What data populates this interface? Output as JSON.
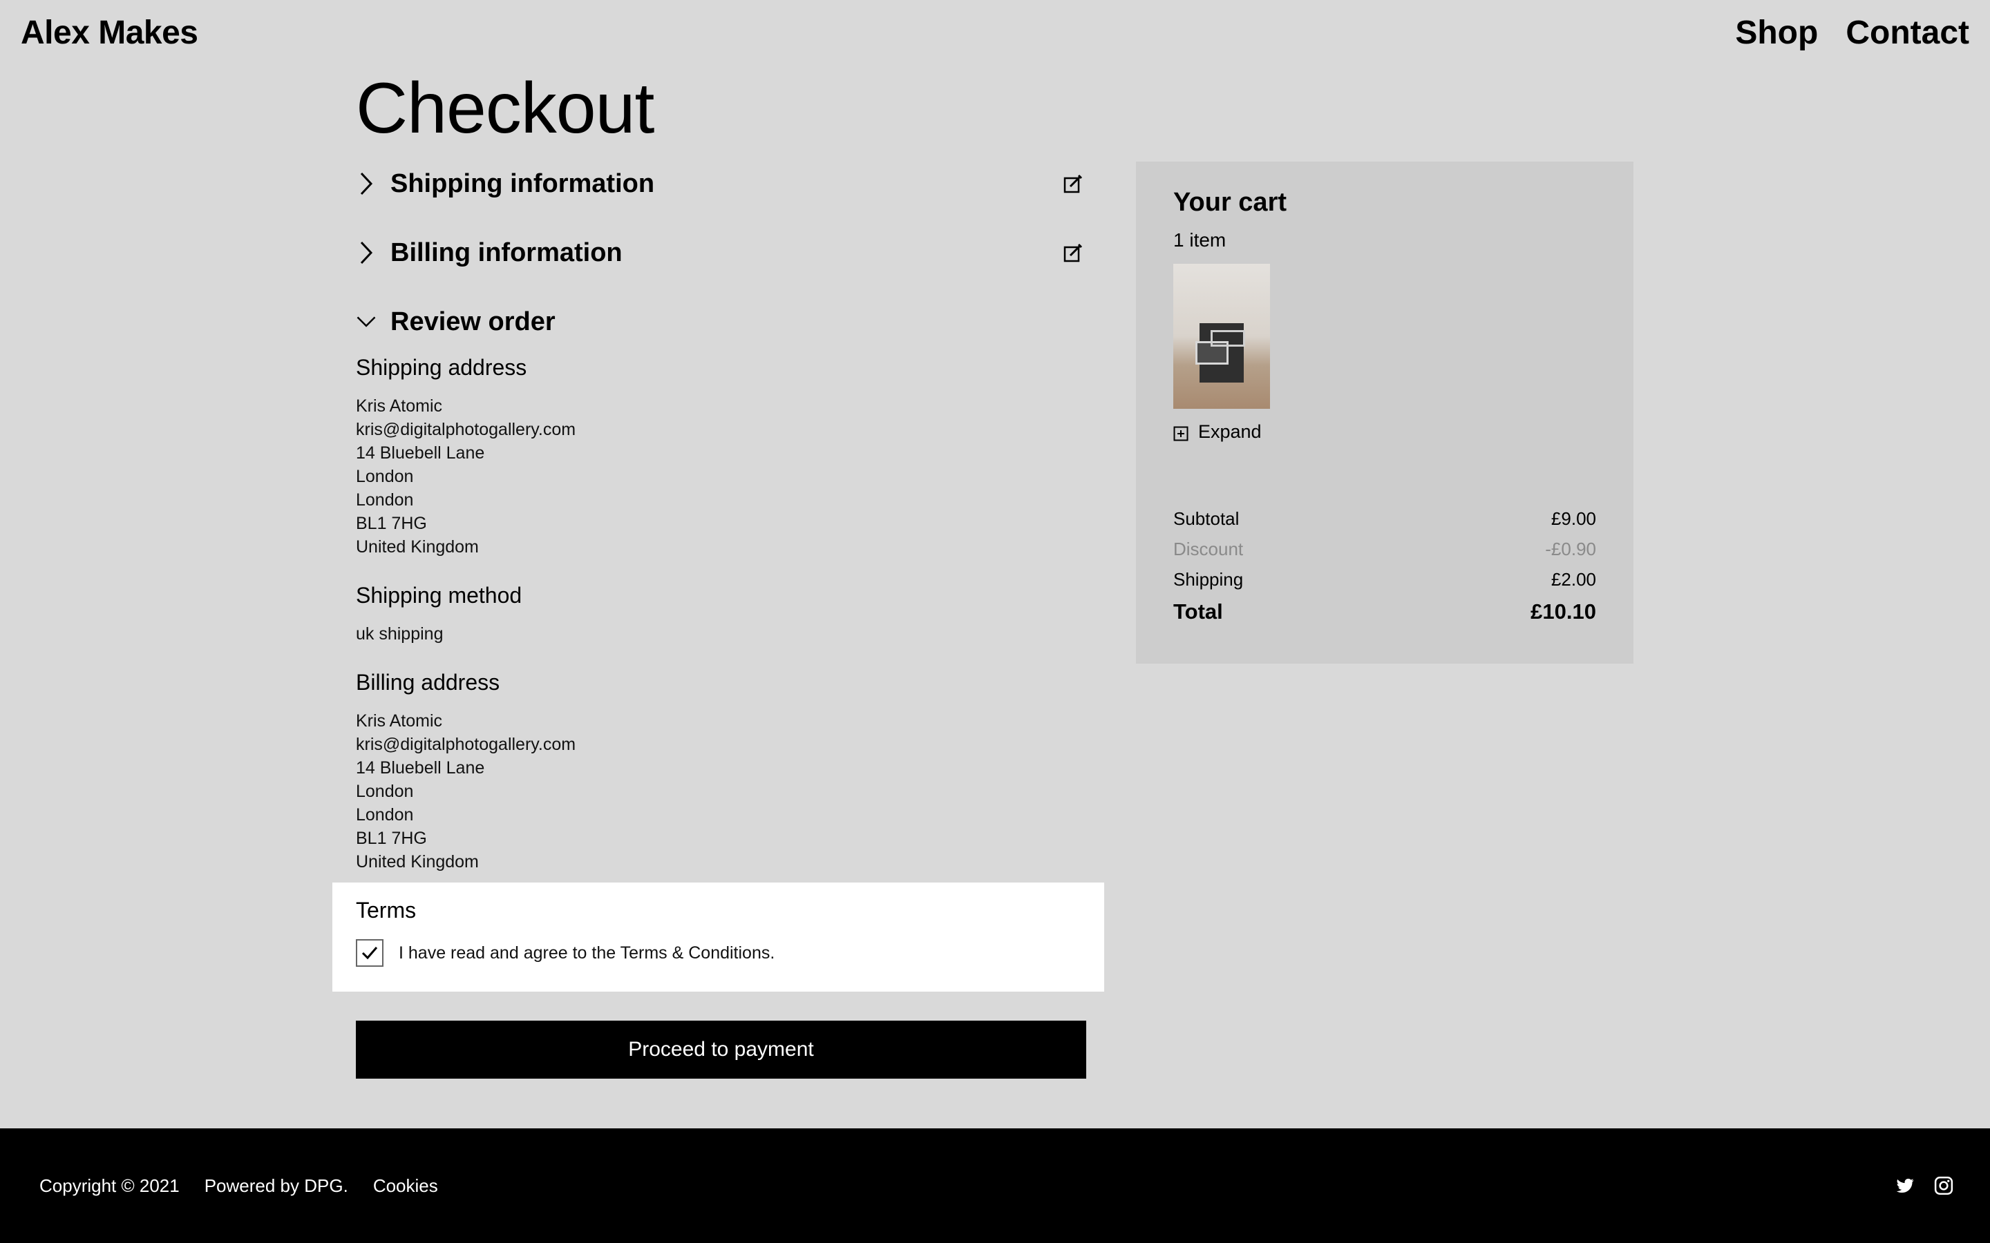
{
  "header": {
    "brand": "Alex Makes",
    "nav": [
      "Shop",
      "Contact"
    ]
  },
  "page_title": "Checkout",
  "sections": {
    "shipping_info": "Shipping information",
    "billing_info": "Billing information",
    "review_order": "Review order"
  },
  "review": {
    "shipping_address_title": "Shipping address",
    "shipping_address": [
      "Kris Atomic",
      "kris@digitalphotogallery.com",
      "14 Bluebell Lane",
      "London",
      "London",
      "BL1 7HG",
      "United Kingdom"
    ],
    "shipping_method_title": "Shipping method",
    "shipping_method": "uk shipping",
    "billing_address_title": "Billing address",
    "billing_address": [
      "Kris Atomic",
      "kris@digitalphotogallery.com",
      "14 Bluebell Lane",
      "London",
      "London",
      "BL1 7HG",
      "United Kingdom"
    ]
  },
  "terms": {
    "title": "Terms",
    "label": "I have read and agree to the Terms & Conditions.",
    "checked": true
  },
  "proceed_label": "Proceed to payment",
  "cart": {
    "title": "Your cart",
    "count": "1 item",
    "expand": "Expand",
    "subtotal_label": "Subtotal",
    "subtotal": "£9.00",
    "discount_label": "Discount",
    "discount": "-£0.90",
    "shipping_label": "Shipping",
    "shipping": "£2.00",
    "total_label": "Total",
    "total": "£10.10"
  },
  "footer": {
    "copyright": "Copyright © 2021",
    "powered": "Powered by DPG.",
    "cookies": "Cookies"
  },
  "icons": {
    "edit": "edit-icon",
    "chevron_right": "chevron-right-icon",
    "chevron_down": "chevron-down-icon",
    "expand": "plus-square-icon",
    "twitter": "twitter-icon",
    "instagram": "instagram-icon"
  },
  "colors": {
    "background": "#d9d9d9",
    "cart_panel": "#cdcdcd",
    "button": "#000000",
    "muted": "#8a8a8a"
  }
}
